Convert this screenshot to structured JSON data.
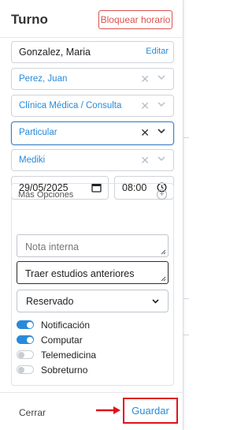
{
  "header": {
    "title": "Turno",
    "block_button": "Bloquear horario"
  },
  "patient": {
    "value": "Gonzalez, Maria",
    "edit_label": "Editar"
  },
  "selects": {
    "professional": "Perez, Juan",
    "service": "Clínica Médica / Consulta",
    "coverage": "Particular",
    "plan": "Mediki"
  },
  "date": "29/05/2025",
  "time": "08:00",
  "more_options": {
    "title": "Más Opciones",
    "note_placeholder": "Nota interna",
    "instructions": "Traer estudios anteriores",
    "status": "Reservado",
    "toggles": {
      "notification": {
        "label": "Notificación",
        "on": true
      },
      "computar": {
        "label": "Computar",
        "on": true
      },
      "telemedicina": {
        "label": "Telemedicina",
        "on": false
      },
      "sobreturno": {
        "label": "Sobreturno",
        "on": false
      }
    }
  },
  "footer": {
    "close_label": "Cerrar",
    "save_label": "Guardar"
  },
  "colors": {
    "accent": "#2a8ad8",
    "danger": "#d9534f",
    "highlight": "#e0121a"
  }
}
